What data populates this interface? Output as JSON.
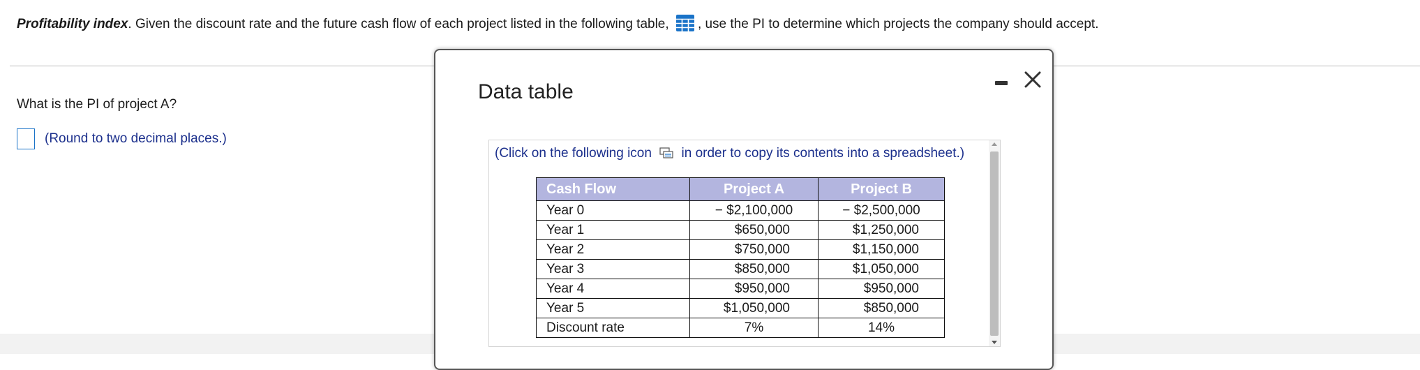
{
  "question": {
    "title": "Profitability index",
    "text_before_icon": ". Given the discount rate and the future cash flow of each project listed in the following table,",
    "text_after_icon": ", use the PI to determine which projects the company should accept."
  },
  "prompt": "What is the PI of project A?",
  "answer": {
    "value": "",
    "note": "(Round to two decimal places.)"
  },
  "modal": {
    "title": "Data table",
    "instruction_before": "(Click on the following icon",
    "instruction_after": "in order to copy its contents into a spreadsheet.)"
  },
  "table": {
    "headers": [
      "Cash Flow",
      "Project A",
      "Project B"
    ],
    "rows": [
      [
        "Year 0",
        "− $2,100,000",
        "− $2,500,000"
      ],
      [
        "Year 1",
        "$650,000",
        "$1,250,000"
      ],
      [
        "Year 2",
        "$750,000",
        "$1,150,000"
      ],
      [
        "Year 3",
        "$850,000",
        "$1,050,000"
      ],
      [
        "Year 4",
        "$950,000",
        "$950,000"
      ],
      [
        "Year 5",
        "$1,050,000",
        "$850,000"
      ],
      [
        "Discount rate",
        "7%",
        "14%"
      ]
    ]
  },
  "icons": [
    "table-grid-icon",
    "copy-spreadsheet-icon",
    "minimize-icon",
    "close-icon"
  ],
  "colors": {
    "header_bg": "#b3b5df",
    "link_blue": "#1b2f8c",
    "icon_blue": "#1a73c8"
  }
}
